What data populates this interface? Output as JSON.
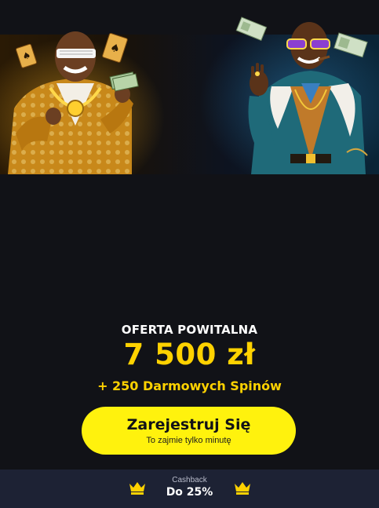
{
  "hero": {
    "image_description_left": "character-gold-suit",
    "image_description_right": "character-fur-coat"
  },
  "offer": {
    "title": "OFERTA POWITALNA",
    "amount": "7 500 zł",
    "spins": "+ 250 Darmowych Spinów"
  },
  "register": {
    "label": "Zarejestruj Się",
    "sublabel": "To zajmie tylko minutę"
  },
  "cashback": {
    "label": "Cashback",
    "value": "Do 25%",
    "icon": "crown-icon"
  },
  "colors": {
    "background": "#111217",
    "accent_yellow": "#ffd200",
    "button_yellow": "#fff20d",
    "bar": "#1d2234"
  }
}
